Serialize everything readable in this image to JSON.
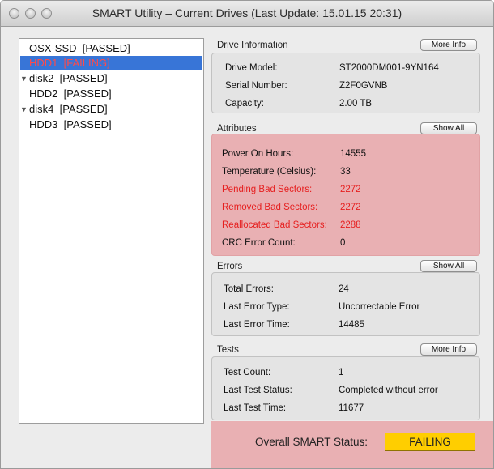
{
  "window": {
    "title": "SMART Utility – Current Drives (Last Update: 15.01.15 20:31)"
  },
  "drives": [
    {
      "name": "OSX-SSD",
      "status": "[PASSED]",
      "expandable": false,
      "selected": false
    },
    {
      "name": "HDD1",
      "status": "[FAILING]",
      "expandable": false,
      "selected": true
    },
    {
      "name": "disk2",
      "status": "[PASSED]",
      "expandable": true,
      "selected": false
    },
    {
      "name": "HDD2",
      "status": "[PASSED]",
      "expandable": false,
      "selected": false
    },
    {
      "name": "disk4",
      "status": "[PASSED]",
      "expandable": true,
      "selected": false
    },
    {
      "name": "HDD3",
      "status": "[PASSED]",
      "expandable": false,
      "selected": false
    }
  ],
  "drive_info": {
    "title": "Drive Information",
    "button": "More Info",
    "rows": [
      {
        "label": "Drive Model:",
        "value": "ST2000DM001-9YN164"
      },
      {
        "label": "Serial Number:",
        "value": "Z2F0GVNB"
      },
      {
        "label": "Capacity:",
        "value": "2.00 TB"
      }
    ]
  },
  "attributes": {
    "title": "Attributes",
    "button": "Show All",
    "rows": [
      {
        "label": "Power On Hours:",
        "value": "14555",
        "bad": false
      },
      {
        "label": "Temperature (Celsius):",
        "value": "33",
        "bad": false
      },
      {
        "label": "Pending Bad Sectors:",
        "value": "2272",
        "bad": true
      },
      {
        "label": "Removed Bad Sectors:",
        "value": "2272",
        "bad": true
      },
      {
        "label": "Reallocated Bad Sectors:",
        "value": "2288",
        "bad": true
      },
      {
        "label": "CRC Error Count:",
        "value": "0",
        "bad": false
      }
    ]
  },
  "errors": {
    "title": "Errors",
    "button": "Show All",
    "rows": [
      {
        "label": "Total Errors:",
        "value": "24"
      },
      {
        "label": "Last Error Type:",
        "value": "Uncorrectable Error"
      },
      {
        "label": "Last Error Time:",
        "value": "14485"
      }
    ]
  },
  "tests": {
    "title": "Tests",
    "button": "More Info",
    "rows": [
      {
        "label": "Test Count:",
        "value": "1"
      },
      {
        "label": "Last Test Status:",
        "value": "Completed without error"
      },
      {
        "label": "Last Test Time:",
        "value": "11677"
      }
    ]
  },
  "overall": {
    "label": "Overall SMART Status:",
    "value": "FAILING"
  },
  "colors": {
    "selection": "#3875d7",
    "failing_text": "#ff4a4a",
    "alert_bg": "#e9b0b3",
    "bad_attr_text": "#e61f1f",
    "status_badge": "#ffce00"
  }
}
